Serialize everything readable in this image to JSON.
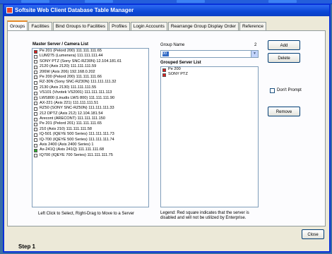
{
  "window": {
    "title": "Softsite Web Client Database Table Manager"
  },
  "tabs": [
    {
      "label": "Groups",
      "active": true
    },
    {
      "label": "Facilities"
    },
    {
      "label": "Bind Groups to Facilities"
    },
    {
      "label": "Profiles"
    },
    {
      "label": "Login Accounts"
    },
    {
      "label": "Rearrange Group Display Order"
    },
    {
      "label": "Reference"
    }
  ],
  "master_list": {
    "header": "Master Server / Camera List",
    "items": [
      {
        "text": "Pe 201 (Pelord 200) 111.111.111.65",
        "color": "#e02020"
      },
      {
        "text": "LUM275 (Lumenera) 111.111.111.44",
        "color": "#ffffff"
      },
      {
        "text": "SONY PTZ (Sony SNC-RZ30N) 12.104.181.61",
        "color": "#ffffff"
      },
      {
        "text": "2120 (Axis 2120) 111.111.111.59",
        "color": "#ffffff"
      },
      {
        "text": "206W (Axis 206) 192.168.0.202",
        "color": "#ffffff"
      },
      {
        "text": "Pe 200 (Pelord 200) 111.111.111.66",
        "color": "#ffffff"
      },
      {
        "text": "RZ-30N (Sony SNC-RZ30N) 111.111.111.32",
        "color": "#ffffff"
      },
      {
        "text": "2130 (Axis 2130) 111.111.111.55",
        "color": "#ffffff"
      },
      {
        "text": "VS101 (Vivotek VS2001) 111.111.111.113",
        "color": "#ffffff"
      },
      {
        "text": "LWS800 (Linudis LWS 800) 111.111.111.90",
        "color": "#ffffff"
      },
      {
        "text": "AX-221 (Axis 221) 111.111.111.51",
        "color": "#ffffff"
      },
      {
        "text": "RZ50 (SONY SNC-RZ50N) 111.111.111.33",
        "color": "#ffffff"
      },
      {
        "text": "212 DPTZ (Axis 212) 12.104.181.54",
        "color": "#ffffff"
      },
      {
        "text": "Arecont (ARECONT) 111.111.111.150",
        "color": "#ffffff"
      },
      {
        "text": "Pe 201 (Pelord 201) 111.111.111.65",
        "color": "#ffffff"
      },
      {
        "text": "210 (Axis 210) 111.111.111.58",
        "color": "#ffffff"
      },
      {
        "text": "IQ-501 (IQEYE 500 Series) 111.111.111.73",
        "color": "#ffffff"
      },
      {
        "text": "IQ-700 (IQEYE 500 Series) 111.111.111.74",
        "color": "#ffffff"
      },
      {
        "text": "Axis 2400 (Axis 2400 Series) 1",
        "color": "#ffffff"
      },
      {
        "text": "Ax-241Q (Axis 241Q) 111.111.111.68",
        "color": "#29b029"
      },
      {
        "text": "IQ700 (IQEYE 700 Series) 111.111.111.75",
        "color": "#ffffff"
      }
    ],
    "hint": "Left Click to Select, Right-Drag to Move to a Server"
  },
  "group": {
    "name_label": "Group Name",
    "counter": "2",
    "selected_value": "00"
  },
  "grouped_list": {
    "header": "Grouped Server List",
    "items": [
      {
        "text": "Pe 200",
        "color": "#e02020"
      },
      {
        "text": "SONY PTZ",
        "color": "#e02020"
      }
    ]
  },
  "legend": "Legend: Red square indicates that the server is disabled and will not be utilized by Enterprise.",
  "buttons": {
    "add": "Add",
    "delete": "Delete",
    "remove": "Remove",
    "close": "Close"
  },
  "dont_prompt_label": "Don't Prompt",
  "footer": {
    "step": "Step 1"
  }
}
